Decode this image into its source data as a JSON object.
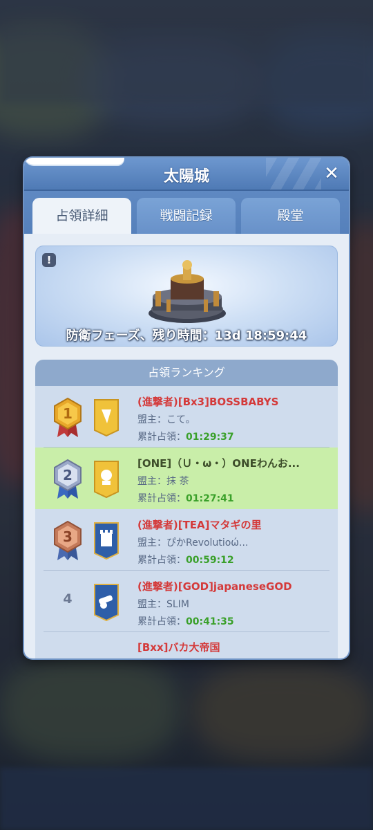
{
  "modal": {
    "title": "太陽城",
    "close_label": "✕"
  },
  "tabs": [
    {
      "label": "占領詳細",
      "active": true
    },
    {
      "label": "戦闘記録",
      "active": false
    },
    {
      "label": "殿堂",
      "active": false
    }
  ],
  "banner": {
    "info_label": "!",
    "defense_text": "防衛フェーズ、残り時間：13d 18:59:44"
  },
  "ranking": {
    "header": "占領ランキング",
    "rows": [
      {
        "rank": "1",
        "name": "(進撃者)[Bx3]BOSSBABYS",
        "leader": "盟主：こて。",
        "time_label": "累計占領：",
        "time": "01:29:37",
        "attacker": true,
        "highlight": false
      },
      {
        "rank": "2",
        "name": "[ONE]（Ｕ・ω・）ONEわんお...",
        "leader": "盟主：抹 茶",
        "time_label": "累計占領：",
        "time": "01:27:41",
        "attacker": false,
        "highlight": true
      },
      {
        "rank": "3",
        "name": "(進撃者)[TEA]マタギの里",
        "leader": "盟主：ぴかRevolutioώ...",
        "time_label": "累計占領：",
        "time": "00:59:12",
        "attacker": true,
        "highlight": false
      },
      {
        "rank": "4",
        "name": "(進撃者)[GOD]japaneseGOD",
        "leader": "盟主：SLIM",
        "time_label": "累計占領：",
        "time": "00:41:35",
        "attacker": true,
        "highlight": false
      }
    ],
    "partial_row": "[Bxx]バカ大帝国"
  },
  "colors": {
    "attacker_red": "#d43a3a",
    "time_green": "#3aa02a",
    "highlight_green": "#c9eea9",
    "header_blue": "#5580bb"
  }
}
